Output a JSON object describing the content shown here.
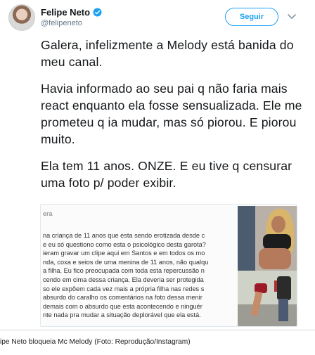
{
  "tweet": {
    "display_name": "Felipe Neto",
    "handle": "@felipeneto",
    "follow_label": "Seguir",
    "paragraphs": [
      "Galera, infelizmente a Melody está banida do meu canal.",
      "Havia informado ao seu pai q não faria mais react enquanto ela fosse sensualizada. Ele me prometeu q ia mudar, mas só piorou. E piorou muito.",
      "Ela tem 11 anos. ONZE. E eu tive q censurar uma foto p/ poder exibir."
    ]
  },
  "attached_image": {
    "header": "era",
    "lines": [
      "na criança de 11 anos que esta sendo erotizada desde c",
      "e eu só questiono como esta o psicológico desta garota?",
      "ieram gravar um clipe aqui em Santos e em todos os mo",
      "nda, coxa e seios de uma menina de 11 anos, não qualqu",
      "a filha. Eu fico preocupada com toda esta repercussão n",
      "cendo em cima dessa criança. Ela deveria ser protegida",
      "so ele expõem cada vez mais a própria filha nas redes s",
      " absurdo do caralho os comentários na foto dessa menir",
      " demais com o absurdo que esta acontecendo e ninguér",
      "nte nada pra mudar a situação deplorável que ela está."
    ]
  },
  "caption": "ipe Neto bloqueia Mc Melody (Foto: Reprodução/Instagram)",
  "colors": {
    "accent": "#1da1f2",
    "text": "#14171a",
    "muted": "#657786"
  }
}
